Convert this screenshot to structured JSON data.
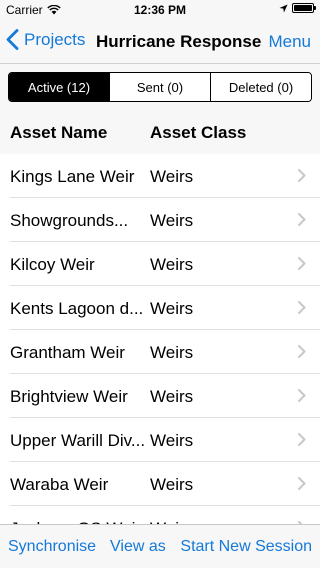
{
  "status_bar": {
    "carrier": "Carrier",
    "time": "12:36 PM",
    "battery_level": 1.0
  },
  "nav": {
    "back_label": "Projects",
    "title": "Hurricane Response",
    "menu_label": "Menu"
  },
  "segments": [
    "Active (12)",
    "Sent (0)",
    "Deleted (0)"
  ],
  "selected_segment": "Active (12)",
  "columns": {
    "name": "Asset Name",
    "class": "Asset Class"
  },
  "rows": [
    {
      "name": "Kings Lane Weir",
      "class": "Weirs"
    },
    {
      "name": "Showgrounds...",
      "class": "Weirs"
    },
    {
      "name": "Kilcoy Weir",
      "class": "Weirs"
    },
    {
      "name": "Kents Lagoon d...",
      "class": "Weirs"
    },
    {
      "name": "Grantham Weir",
      "class": "Weirs"
    },
    {
      "name": "Brightview Weir",
      "class": "Weirs"
    },
    {
      "name": "Upper Warill Div...",
      "class": "Weirs"
    },
    {
      "name": "Waraba Weir",
      "class": "Weirs"
    },
    {
      "name": "Jackson GS Weir",
      "class": "Weirs"
    }
  ],
  "toolbar": {
    "sync_label": "Synchronise",
    "view_label": "View as",
    "new_session_label": "Start New Session"
  },
  "colors": {
    "accent": "#1479d9",
    "chrome": "#f7f7f7"
  }
}
